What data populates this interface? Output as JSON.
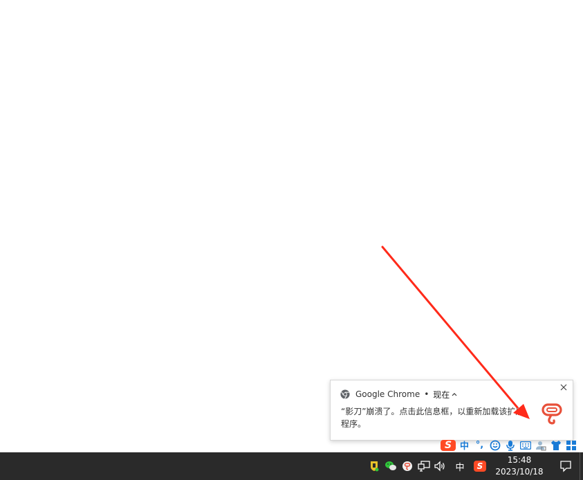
{
  "notification": {
    "app_name": "Google Chrome",
    "separator": "•",
    "time": "现在",
    "chevron": "^",
    "close": "×",
    "message": "“影刀”崩溃了。点击此信息框，以重新加载该扩展程序。",
    "icons": {
      "app": "chrome-icon",
      "extension": "yingdao-icon"
    }
  },
  "ime_toolbar": {
    "logo": "S",
    "mode": "中",
    "punct": "°,",
    "icons": [
      "sogou-logo-icon",
      "chinese-mode-icon",
      "punctuation-icon",
      "emoji-icon",
      "microphone-icon",
      "keyboard-icon",
      "user-icon",
      "skin-icon",
      "toolbox-icon"
    ]
  },
  "taskbar": {
    "tray": {
      "ime_language": "中",
      "sogou_label": "S",
      "time": "15:48",
      "date": "2023/10/18",
      "icons": [
        "security-shield-icon",
        "wechat-icon",
        "app-tray-icon",
        "network-icon",
        "volume-icon",
        "sogou-ime-icon",
        "action-center-icon"
      ]
    }
  },
  "colors": {
    "taskbar_bg": "#2a2a2a",
    "arrow_red": "#ff2a1a",
    "sogou_orange": "#ff4a25",
    "ime_blue": "#1a7bd6",
    "yingdao_red": "#e8503a"
  }
}
